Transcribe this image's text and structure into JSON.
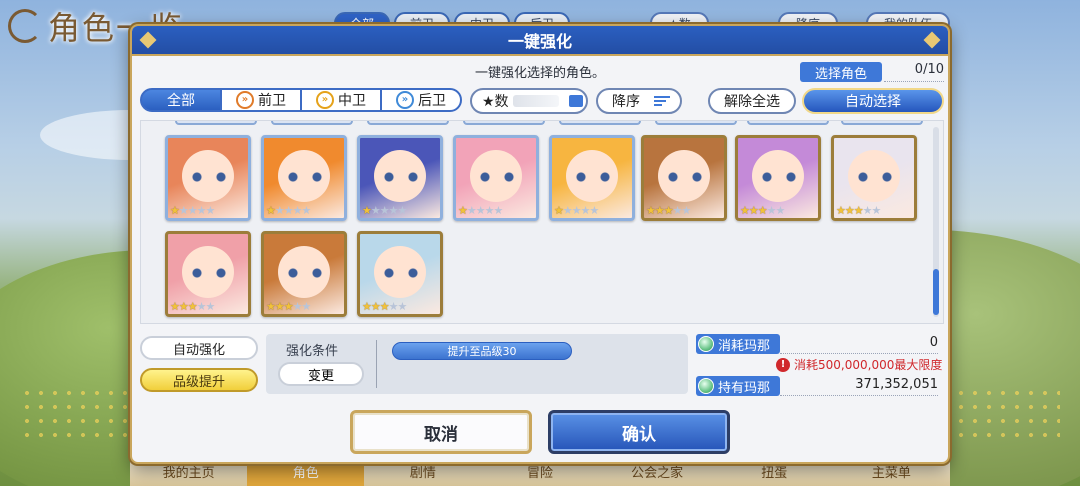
{
  "background": {
    "title": "角色一览",
    "tabs": [
      "全部",
      "前卫",
      "中卫",
      "后卫"
    ],
    "right_buttons": [
      "★数",
      "降序",
      "我的队伍"
    ],
    "bottom_nav": [
      "我的主页",
      "角色",
      "剧情",
      "冒险",
      "公会之家",
      "扭蛋",
      "主菜单"
    ],
    "bottom_nav_active": 1
  },
  "dialog": {
    "title": "一键强化",
    "description": "一键强化选择的角色。",
    "select_label": "选择角色",
    "select_count": "0/10",
    "filter_tabs": [
      {
        "label": "全部",
        "icon": "none"
      },
      {
        "label": "前卫",
        "icon": "front-chevron-icon"
      },
      {
        "label": "中卫",
        "icon": "middle-chevron-icon"
      },
      {
        "label": "后卫",
        "icon": "back-chevron-icon"
      }
    ],
    "star_sort_label": "★数",
    "order_label": "降序",
    "deselect_all_label": "解除全选",
    "auto_select_label": "自动选择",
    "characters": [
      {
        "stars": 1,
        "hair": "#e8855a",
        "frame": "blue"
      },
      {
        "stars": 1,
        "hair": "#f08a2e",
        "frame": "blue"
      },
      {
        "stars": 1,
        "hair": "#4b56b8",
        "frame": "blue"
      },
      {
        "stars": 1,
        "hair": "#f2a3b8",
        "frame": "blue"
      },
      {
        "stars": 1,
        "hair": "#f7b540",
        "frame": "blue"
      },
      {
        "stars": 3,
        "hair": "#b8743e",
        "frame": "gold"
      },
      {
        "stars": 3,
        "hair": "#c48ad8",
        "frame": "gold"
      },
      {
        "stars": 3,
        "hair": "#e9e4ee",
        "frame": "gold"
      },
      {
        "stars": 3,
        "hair": "#f0a0a8",
        "frame": "gold"
      },
      {
        "stars": 3,
        "hair": "#c97a3a",
        "frame": "gold"
      },
      {
        "stars": 3,
        "hair": "#b9d8ea",
        "frame": "gold"
      }
    ],
    "auto_enhance_label": "自动强化",
    "rank_up_label": "品级提升",
    "condition_title": "强化条件",
    "change_label": "变更",
    "condition_tag": "提升至品级30",
    "mana_cost_label": "消耗玛那",
    "mana_cost_value": "0",
    "warning": "消耗500,000,000最大限度",
    "mana_owned_label": "持有玛那",
    "mana_owned_value": "371,352,051",
    "cancel_label": "取消",
    "confirm_label": "确认"
  },
  "colors": {
    "accent": "#2b5fc0",
    "gold_border": "#c9a65c",
    "warning": "#d0282c"
  }
}
